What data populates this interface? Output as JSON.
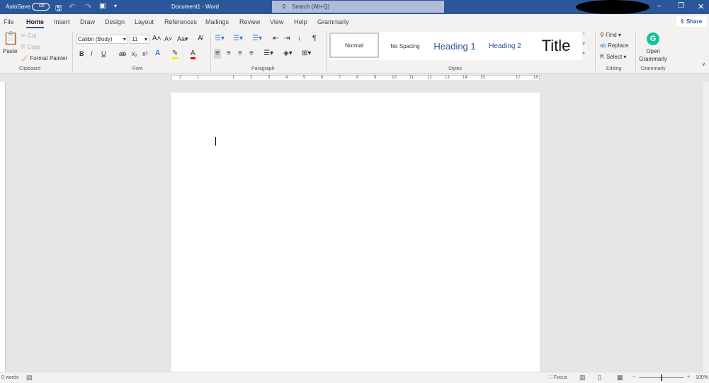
{
  "titlebar": {
    "autosave": "AutoSave",
    "autosave_state": "Off",
    "title": "Document1 - Word",
    "search_placeholder": "Search (Alt+Q)",
    "brand_color": "#2b579a"
  },
  "tabs": [
    "File",
    "Home",
    "Insert",
    "Draw",
    "Design",
    "Layout",
    "References",
    "Mailings",
    "Review",
    "View",
    "Help",
    "Grammarly"
  ],
  "share": "Share",
  "clipboard": {
    "paste": "Paste",
    "cut": "Cut",
    "copy": "Copy",
    "format_painter": "Format Painter",
    "label": "Clipboard"
  },
  "font": {
    "name": "Calibri (Body)",
    "size": "11",
    "label": "Font",
    "bold": "B",
    "italic": "I",
    "underline": "U"
  },
  "paragraph": {
    "label": "Paragraph"
  },
  "styles": {
    "items": [
      "Normal",
      "No Spacing",
      "Heading 1",
      "Heading 2",
      "Title"
    ],
    "label": "Styles"
  },
  "editing": {
    "find": "Find",
    "replace": "Replace",
    "select": "Select",
    "label": "Editing"
  },
  "grammarly": {
    "open": "Open",
    "name": "Grammarly",
    "label": "Grammarly",
    "color": "#15c39a"
  },
  "ruler": [
    "2",
    "1",
    "",
    "1",
    "2",
    "3",
    "4",
    "5",
    "6",
    "7",
    "8",
    "9",
    "10",
    "11",
    "12",
    "13",
    "14",
    "15",
    "",
    "17",
    "18"
  ],
  "status": {
    "words": "0 words",
    "focus": "Focus",
    "zoom": "100%"
  }
}
